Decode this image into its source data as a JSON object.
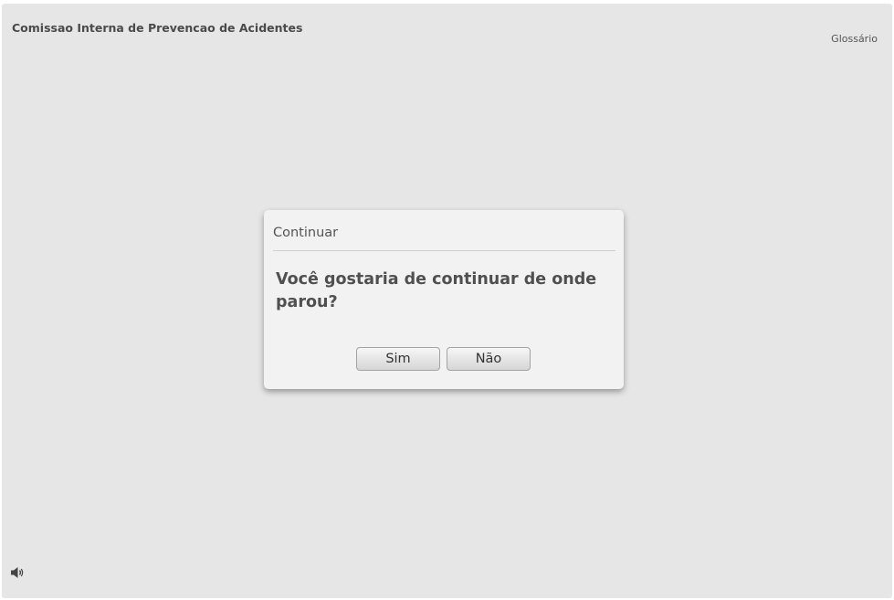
{
  "header": {
    "course_title": "Comissao Interna de Prevencao de Acidentes",
    "glossary_label": "Glossário"
  },
  "footer": {
    "volume_icon": "speaker-icon"
  },
  "dialog": {
    "title": "Continuar",
    "message": "Você gostaria de continuar de onde parou?",
    "yes_label": "Sim",
    "no_label": "Não"
  },
  "colors": {
    "background": "#e6e6e6",
    "dialog_background": "#f2f2f2",
    "text": "#505050"
  }
}
